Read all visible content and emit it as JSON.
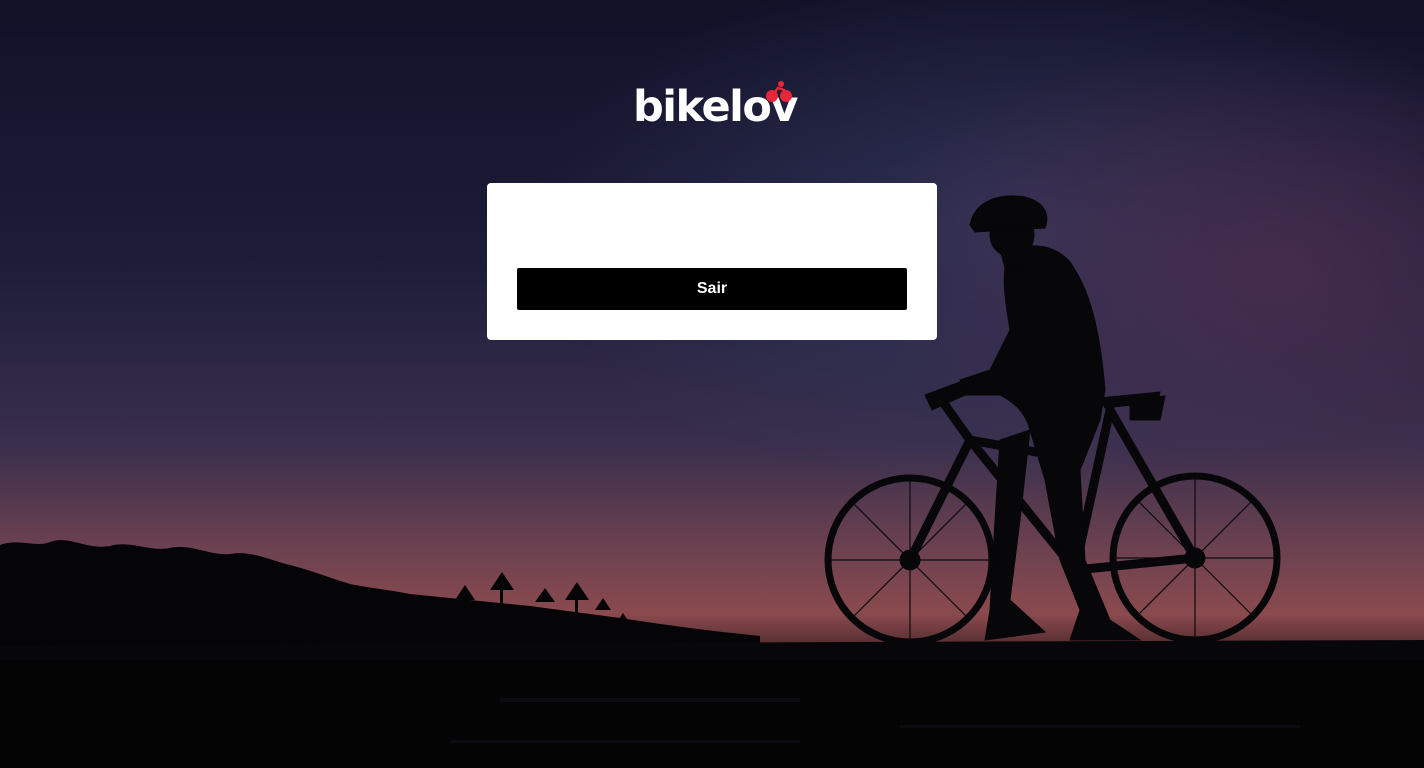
{
  "brand": {
    "logo_text": "bikelov",
    "logo_color": "#ffffff",
    "accent_color": "#e8263a"
  },
  "background": {
    "icon": "cyclist-silhouette-at-dusk",
    "sky_top_color": "#14142e",
    "horizon_color": "#8a4a4e"
  },
  "card": {
    "logout_label": "Sair",
    "button_color": "#000000"
  }
}
